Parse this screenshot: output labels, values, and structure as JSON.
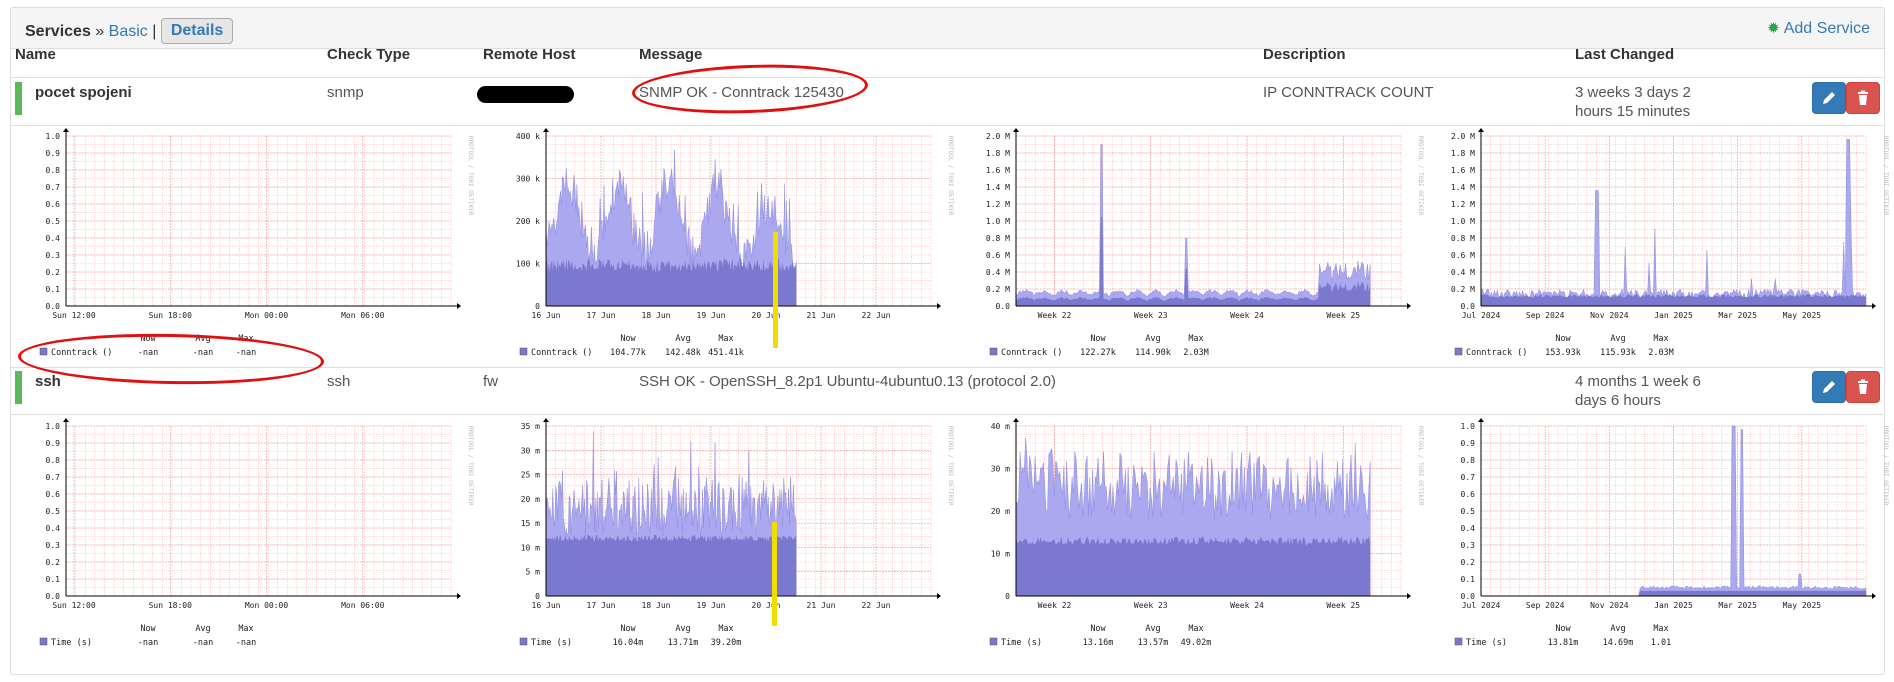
{
  "breadcrumb": {
    "section": "Services",
    "separator": "»",
    "basic": "Basic",
    "pipe": "|",
    "details": "Details"
  },
  "header_action": {
    "label": "Add Service",
    "icon": "gear-icon"
  },
  "columns": [
    "Name",
    "Check Type",
    "Remote Host",
    "Message",
    "Description",
    "Last Changed"
  ],
  "colors": {
    "status_ok": "#5cb85c",
    "edit": "#337ab7",
    "delete": "#d9534f",
    "area": "#7b78cf",
    "area_light": "#aaa8ee",
    "grid": "#f5b7b7",
    "annotation": "#e01010",
    "highlight": "#f2dd00"
  },
  "services": [
    {
      "name": "pocet spojeni",
      "check_type": "snmp",
      "remote_host": "",
      "message": "SNMP OK - Conntrack 125430",
      "description": "IP CONNTRACK COUNT",
      "last_changed_1": "3 weeks 3 days 2",
      "last_changed_2": "hours 15 minutes",
      "graphs": [
        {
          "type": "area",
          "legend": "Conntrack ()",
          "watermark": "RRDTOOL / TOBI OETIKER",
          "ylabels": [
            "1.0",
            "0.9",
            "0.8",
            "0.7",
            "0.6",
            "0.5",
            "0.4",
            "0.3",
            "0.2",
            "0.1",
            "0.0"
          ],
          "xlabels": [
            "Sun 12:00",
            "Sun 18:00",
            "Mon 00:00",
            "Mon 06:00"
          ],
          "stats": {
            "now": "-nan",
            "avg": "-nan",
            "max": "-nan"
          },
          "pattern": "empty"
        },
        {
          "type": "area",
          "legend": "Conntrack ()",
          "watermark": "RRDTOOL / TOBI OETIKER",
          "ylabels": [
            "400 k",
            "300 k",
            "200 k",
            "100 k",
            "0"
          ],
          "xlabels": [
            "16 Jun",
            "17 Jun",
            "18 Jun",
            "19 Jun",
            "20 Jun",
            "21 Jun",
            "22 Jun"
          ],
          "stats": {
            "now": "104.77k",
            "avg": "142.48k",
            "max": "451.41k"
          },
          "pattern": "daily"
        },
        {
          "type": "area",
          "legend": "Conntrack ()",
          "watermark": "RRDTOOL / TOBI OETIKER",
          "ylabels": [
            "2.0 M",
            "1.8 M",
            "1.6 M",
            "1.4 M",
            "1.2 M",
            "1.0 M",
            "0.8 M",
            "0.6 M",
            "0.4 M",
            "0.2 M",
            "0.0"
          ],
          "xlabels": [
            "Week 22",
            "Week 23",
            "Week 24",
            "Week 25"
          ],
          "stats": {
            "now": "122.27k",
            "avg": "114.90k",
            "max": "2.03M"
          },
          "pattern": "weekly"
        },
        {
          "type": "area",
          "legend": "Conntrack ()",
          "watermark": "RRDTOOL / TOBI OETIKER",
          "ylabels": [
            "2.0 M",
            "1.8 M",
            "1.6 M",
            "1.4 M",
            "1.2 M",
            "1.0 M",
            "0.8 M",
            "0.6 M",
            "0.4 M",
            "0.2 M",
            "0.0"
          ],
          "xlabels": [
            "Jul 2024",
            "Sep 2024",
            "Nov 2024",
            "Jan 2025",
            "Mar 2025",
            "May 2025"
          ],
          "stats": {
            "now": "153.93k",
            "avg": "115.93k",
            "max": "2.03M"
          },
          "pattern": "yearly"
        }
      ]
    },
    {
      "name": "ssh",
      "check_type": "ssh",
      "remote_host": "fw",
      "message": "SSH OK - OpenSSH_8.2p1 Ubuntu-4ubuntu0.13 (protocol 2.0)",
      "description": "",
      "last_changed_1": "4 months 1 week 6",
      "last_changed_2": "days 6 hours",
      "graphs": [
        {
          "type": "area",
          "legend": "Time (s)",
          "watermark": "RRDTOOL / TOBI OETIKER",
          "ylabels": [
            "1.0",
            "0.9",
            "0.8",
            "0.7",
            "0.6",
            "0.5",
            "0.4",
            "0.3",
            "0.2",
            "0.1",
            "0.0"
          ],
          "xlabels": [
            "Sun 12:00",
            "Sun 18:00",
            "Mon 00:00",
            "Mon 06:00"
          ],
          "stats": {
            "now": "-nan",
            "avg": "-nan",
            "max": "-nan"
          },
          "pattern": "empty"
        },
        {
          "type": "area",
          "legend": "Time (s)",
          "watermark": "RRDTOOL / TOBI OETIKER",
          "ylabels": [
            "35 m",
            "30 m",
            "25 m",
            "20 m",
            "15 m",
            "10 m",
            "5 m",
            "0"
          ],
          "xlabels": [
            "16 Jun",
            "17 Jun",
            "18 Jun",
            "19 Jun",
            "20 Jun",
            "21 Jun",
            "22 Jun"
          ],
          "stats": {
            "now": "16.04m",
            "avg": "13.71m",
            "max": "39.20m"
          },
          "pattern": "daily_ssh"
        },
        {
          "type": "area",
          "legend": "Time (s)",
          "watermark": "RRDTOOL / TOBI OETIKER",
          "ylabels": [
            "40 m",
            "30 m",
            "20 m",
            "10 m",
            "0"
          ],
          "xlabels": [
            "Week 22",
            "Week 23",
            "Week 24",
            "Week 25"
          ],
          "stats": {
            "now": "13.16m",
            "avg": "13.57m",
            "max": "49.02m"
          },
          "pattern": "weekly_ssh"
        },
        {
          "type": "area",
          "legend": "Time (s)",
          "watermark": "RRDTOOL / TOBI OETIKER",
          "ylabels": [
            "1.0",
            "0.9",
            "0.8",
            "0.7",
            "0.6",
            "0.5",
            "0.4",
            "0.3",
            "0.2",
            "0.1",
            "0.0"
          ],
          "xlabels": [
            "Jul 2024",
            "Sep 2024",
            "Nov 2024",
            "Jan 2025",
            "Mar 2025",
            "May 2025"
          ],
          "stats": {
            "now": "13.81m",
            "avg": "14.69m",
            "max": "1.01"
          },
          "pattern": "yearly_ssh"
        }
      ]
    }
  ],
  "stat_headers": {
    "now": "Now",
    "avg": "Avg",
    "max": "Max"
  }
}
